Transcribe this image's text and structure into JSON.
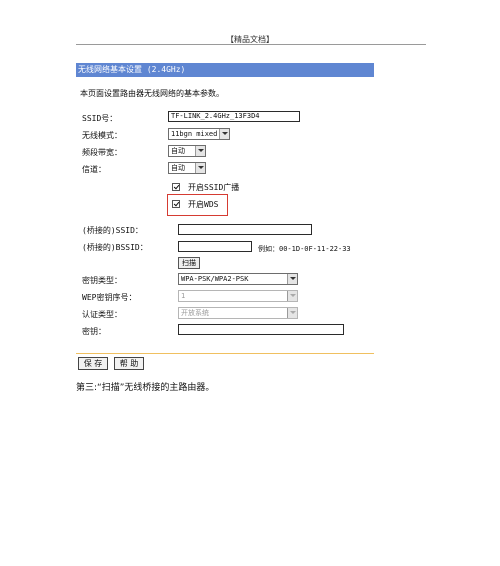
{
  "document": {
    "header": "【精品文档】",
    "caption": "第三:“扫描”无线桥接的主路由器。"
  },
  "panel": {
    "title": "无线网络基本设置 (2.4GHz)",
    "description": "本页面设置路由器无线网络的基本参数。",
    "fields": {
      "ssid": {
        "label": "SSID号：",
        "value": "TF-LINK_2.4GHz_13F3D4"
      },
      "mode": {
        "label": "无线模式：",
        "value": "11bgn mixed"
      },
      "bandwidth": {
        "label": "频段带宽：",
        "value": "自动"
      },
      "channel": {
        "label": "信道：",
        "value": "自动"
      },
      "ssid_broadcast": {
        "label": "开启SSID广播",
        "checked": true
      },
      "wds": {
        "label": "开启WDS",
        "checked": true
      },
      "bridge_ssid": {
        "label": "(桥接的)SSID：",
        "value": ""
      },
      "bridge_bssid": {
        "label": "(桥接的)BSSID：",
        "value": "",
        "example": "例如：00-1D-0F-11-22-33"
      },
      "scan_button": "扫描",
      "key_type": {
        "label": "密钥类型：",
        "value": "WPA-PSK/WPA2-PSK"
      },
      "wep_index": {
        "label": "WEP密钥序号：",
        "value": "1"
      },
      "auth_type": {
        "label": "认证类型：",
        "value": "开放系统"
      },
      "key": {
        "label": "密钥：",
        "value": ""
      }
    },
    "buttons": {
      "save": "保 存",
      "help": "帮 助"
    }
  },
  "colors": {
    "titlebar": "#5f86d2",
    "highlight": "#d53b32",
    "bottom_rule": "#f0c060"
  }
}
